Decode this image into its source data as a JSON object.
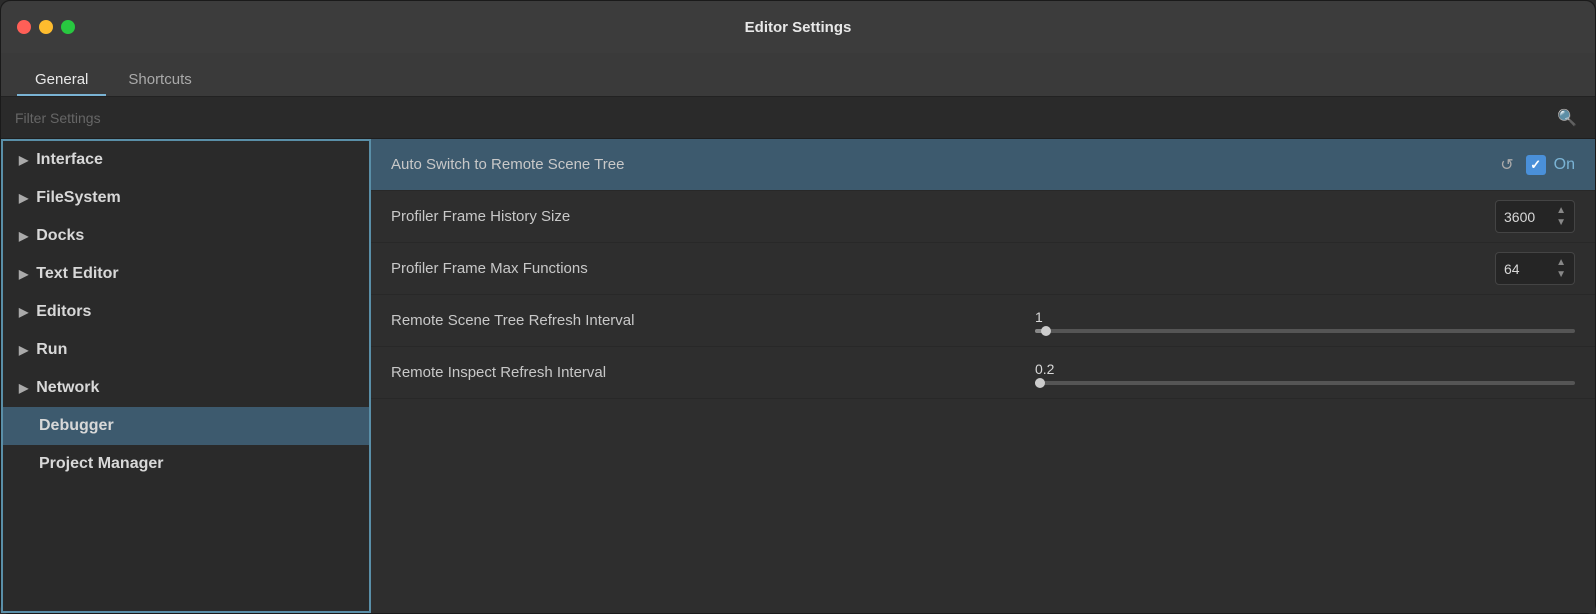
{
  "window": {
    "title": "Editor Settings"
  },
  "tabs": [
    {
      "id": "general",
      "label": "General",
      "active": true
    },
    {
      "id": "shortcuts",
      "label": "Shortcuts",
      "active": false
    }
  ],
  "filter": {
    "placeholder": "Filter Settings"
  },
  "sidebar": {
    "items": [
      {
        "id": "interface",
        "label": "Interface",
        "active": false
      },
      {
        "id": "filesystem",
        "label": "FileSystem",
        "active": false
      },
      {
        "id": "docks",
        "label": "Docks",
        "active": false
      },
      {
        "id": "text-editor",
        "label": "Text Editor",
        "active": false
      },
      {
        "id": "editors",
        "label": "Editors",
        "active": false
      },
      {
        "id": "run",
        "label": "Run",
        "active": false
      },
      {
        "id": "network",
        "label": "Network",
        "active": false
      },
      {
        "id": "debugger",
        "label": "Debugger",
        "active": true
      },
      {
        "id": "project-manager",
        "label": "Project Manager",
        "active": false
      }
    ]
  },
  "settings": {
    "rows": [
      {
        "id": "auto-switch",
        "label": "Auto Switch to Remote Scene Tree",
        "type": "checkbox",
        "value": "On",
        "checked": true,
        "highlighted": true
      },
      {
        "id": "profiler-history",
        "label": "Profiler Frame History Size",
        "type": "spinbox",
        "value": "3600"
      },
      {
        "id": "profiler-max",
        "label": "Profiler Frame Max Functions",
        "type": "spinbox",
        "value": "64"
      },
      {
        "id": "scene-refresh",
        "label": "Remote Scene Tree Refresh Interval",
        "type": "slider",
        "value": "1",
        "percent": 2
      },
      {
        "id": "inspect-refresh",
        "label": "Remote Inspect Refresh Interval",
        "type": "slider",
        "value": "0.2",
        "percent": 1
      }
    ],
    "on_label": "On",
    "reset_icon": "↺"
  },
  "icons": {
    "search": "🔍",
    "arrow_right": "▶",
    "spin_up": "▲",
    "spin_down": "▼"
  },
  "colors": {
    "accent_blue": "#4a90d9",
    "sidebar_active": "#3d5a6e",
    "row_active_bg": "#3d5a6e"
  }
}
